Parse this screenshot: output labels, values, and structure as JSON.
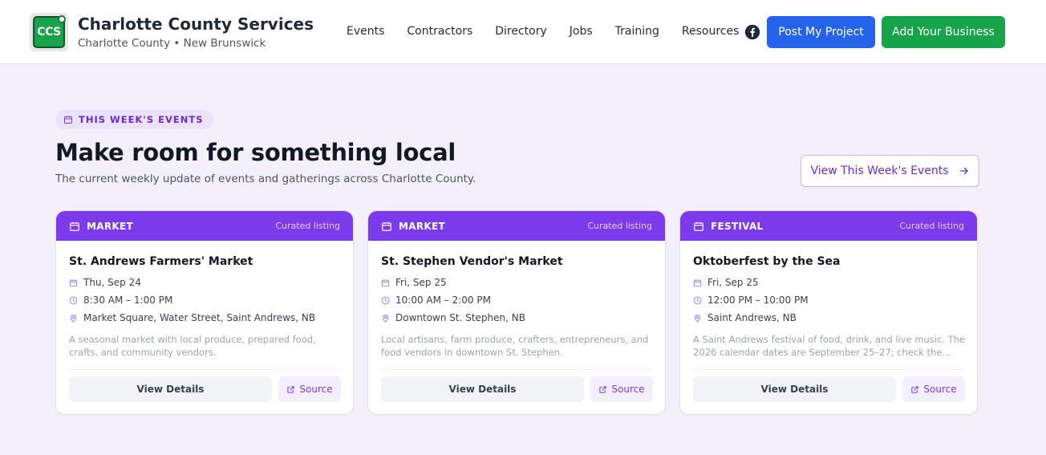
{
  "header": {
    "logo_text": "CCS",
    "title": "Charlotte County Services",
    "subtitle": "Charlotte County • New Brunswick",
    "nav": [
      "Events",
      "Contractors",
      "Directory",
      "Jobs",
      "Training",
      "Resources"
    ],
    "post_project": "Post My Project",
    "add_business": "Add Your Business",
    "facebook_icon": "facebook-icon"
  },
  "section": {
    "pill": "THIS WEEK'S EVENTS",
    "headline": "Make room for something local",
    "subline": "The current weekly update of events and gatherings across Charlotte County.",
    "view_button": "View This Week's Events"
  },
  "cards": [
    {
      "type": "MARKET",
      "curated": "Curated listing",
      "title": "St. Andrews Farmers' Market",
      "date": "Thu, Sep 24",
      "time": "8:30 AM – 1:00 PM",
      "location": "Market Square, Water Street, Saint Andrews, NB",
      "description": "A seasonal market with local produce, prepared food, crafts, and community vendors.",
      "details": "View Details",
      "source": "Source"
    },
    {
      "type": "MARKET",
      "curated": "Curated listing",
      "title": "St. Stephen Vendor's Market",
      "date": "Fri, Sep 25",
      "time": "10:00 AM – 2:00 PM",
      "location": "Downtown St. Stephen, NB",
      "description": "Local artisans, farm produce, crafters, entrepreneurs, and food vendors in downtown St. Stephen.",
      "details": "View Details",
      "source": "Source"
    },
    {
      "type": "FESTIVAL",
      "curated": "Curated listing",
      "title": "Oktoberfest by the Sea",
      "date": "Fri, Sep 25",
      "time": "12:00 PM – 10:00 PM",
      "location": "Saint Andrews, NB",
      "description": "A Saint Andrews festival of food, drink, and live music. The 2026 calendar dates are September 25–27; check the…",
      "details": "View Details",
      "source": "Source"
    }
  ],
  "colors": {
    "accent_purple": "#7c3aed",
    "primary_blue": "#2563eb",
    "success_green": "#16a34a",
    "page_bg": "#f3f0fb"
  }
}
